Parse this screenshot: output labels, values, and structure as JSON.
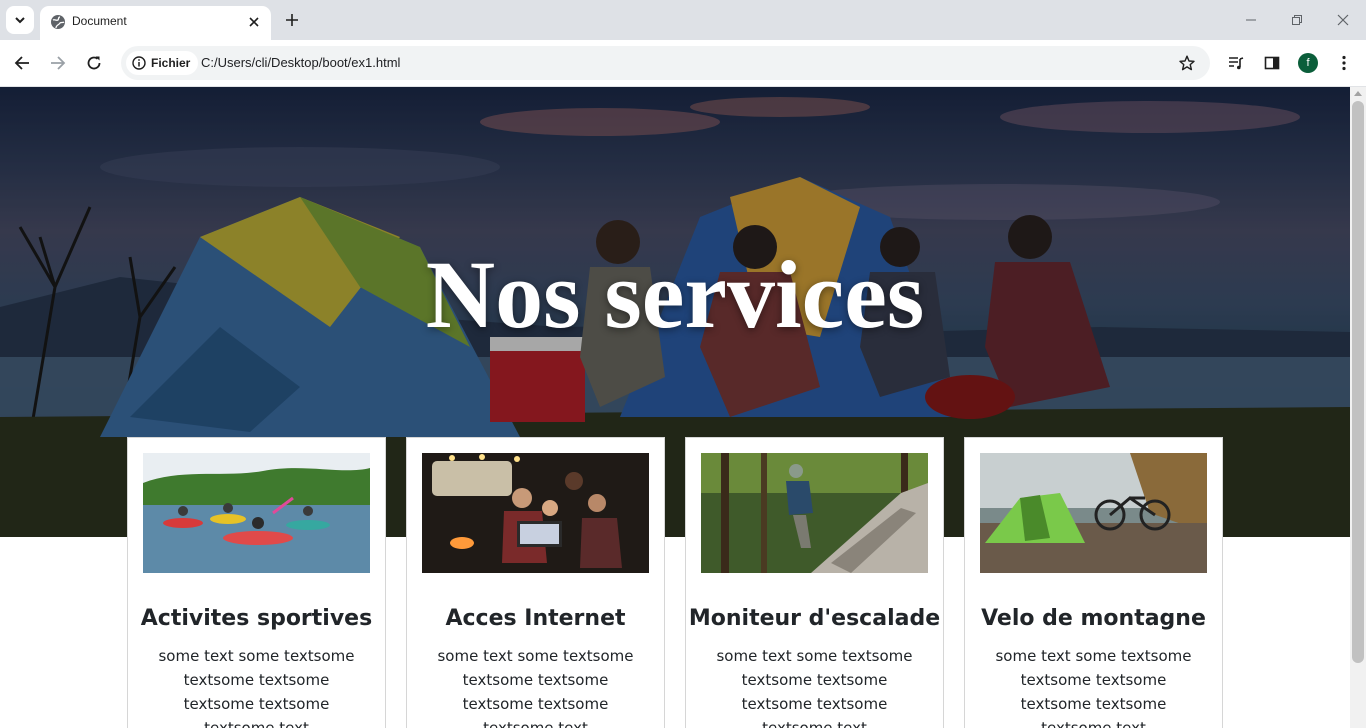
{
  "browser": {
    "tab_title": "Document",
    "security_chip": "Fichier",
    "url": "C:/Users/cli/Desktop/boot/ex1.html",
    "profile_initial": "f"
  },
  "page": {
    "hero_title": "Nos services",
    "cards": [
      {
        "title": "Activites sportives",
        "text": "some text some textsome textsome textsome textsome textsome textsome text"
      },
      {
        "title": "Acces Internet",
        "text": "some text some textsome textsome textsome textsome textsome textsome text"
      },
      {
        "title": "Moniteur d'escalade",
        "text": "some text some textsome textsome textsome textsome textsome textsome text"
      },
      {
        "title": "Velo de montagne",
        "text": "some text some textsome textsome textsome textsome textsome textsome text"
      }
    ]
  },
  "colors": {
    "browser_chrome": "#dee1e6",
    "omnibox": "#f1f3f4",
    "avatar": "#0b5e3a",
    "text_dark": "#212529"
  }
}
